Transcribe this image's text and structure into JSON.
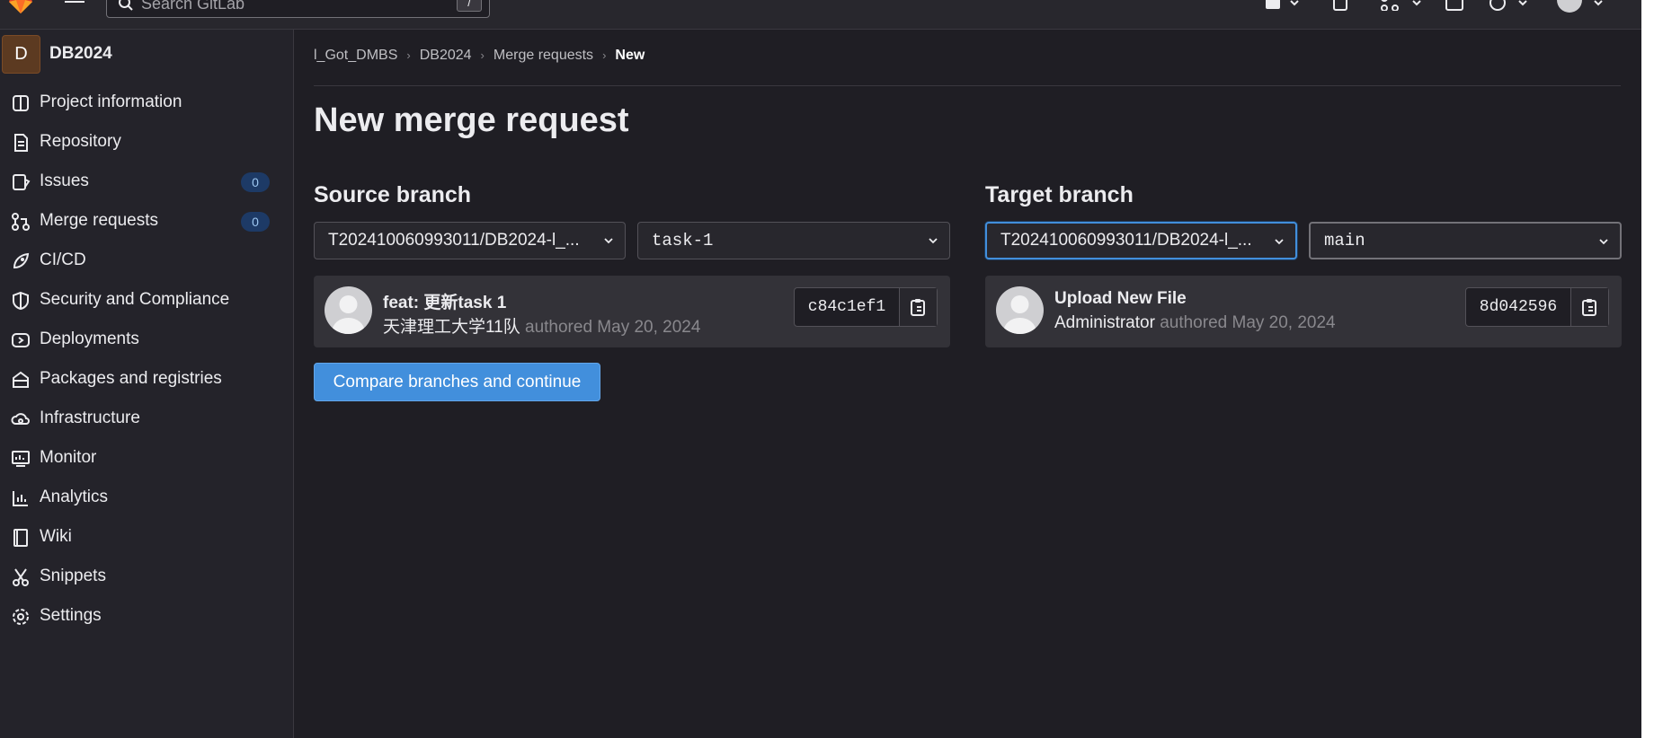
{
  "header": {
    "search_placeholder": "Search GitLab",
    "search_shortcut": "/"
  },
  "sidebar": {
    "project_avatar_letter": "D",
    "project_name": "DB2024",
    "items": [
      {
        "label": "Project information",
        "icon": "project-icon"
      },
      {
        "label": "Repository",
        "icon": "doc-icon"
      },
      {
        "label": "Issues",
        "icon": "issues-icon",
        "badge": "0"
      },
      {
        "label": "Merge requests",
        "icon": "merge-request-icon",
        "badge": "0"
      },
      {
        "label": "CI/CD",
        "icon": "rocket-icon"
      },
      {
        "label": "Security and Compliance",
        "icon": "shield-icon"
      },
      {
        "label": "Deployments",
        "icon": "deployments-icon"
      },
      {
        "label": "Packages and registries",
        "icon": "package-icon"
      },
      {
        "label": "Infrastructure",
        "icon": "cloud-gear-icon"
      },
      {
        "label": "Monitor",
        "icon": "monitor-icon"
      },
      {
        "label": "Analytics",
        "icon": "chart-icon"
      },
      {
        "label": "Wiki",
        "icon": "book-icon"
      },
      {
        "label": "Snippets",
        "icon": "scissors-icon"
      },
      {
        "label": "Settings",
        "icon": "gear-icon"
      }
    ]
  },
  "breadcrumb": [
    "l_Got_DMBS",
    "DB2024",
    "Merge requests",
    "New"
  ],
  "page_title": "New merge request",
  "source": {
    "title": "Source branch",
    "project": "T202410060993011/DB2024-l_...",
    "branch": "task-1",
    "commit_title": "feat: 更新task 1",
    "commit_author": "天津理工大学11队",
    "commit_meta": " authored May 20, 2024",
    "sha": "c84c1ef1"
  },
  "target": {
    "title": "Target branch",
    "project": "T202410060993011/DB2024-l_...",
    "branch": "main",
    "commit_title": "Upload New File",
    "commit_author": "Administrator",
    "commit_meta": " authored May 20, 2024",
    "sha": "8d042596"
  },
  "compare_button": "Compare branches and continue",
  "colors": {
    "accent": "#428fdc",
    "background": "#1f1e24",
    "sidebar": "#24232a"
  }
}
